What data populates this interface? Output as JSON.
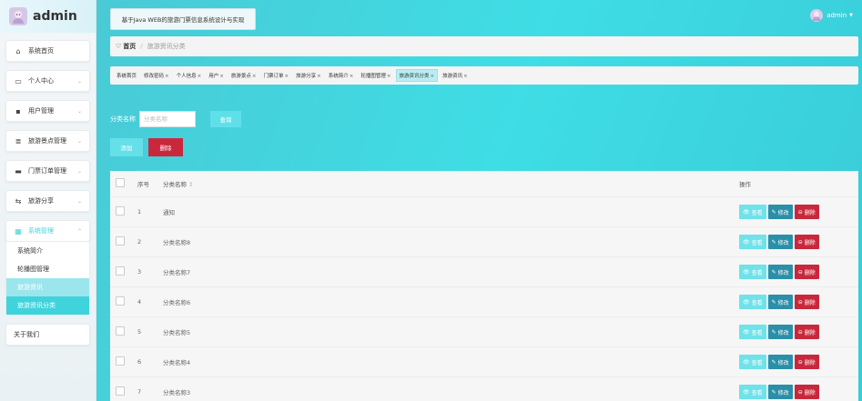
{
  "brand": {
    "name": "admin"
  },
  "header": {
    "system_title": "基于Java WEB的旅游门票信息系统设计与实现",
    "user_label": "admin"
  },
  "sidebar": {
    "items": [
      {
        "label": "系统首页",
        "icon": "home-icon"
      },
      {
        "label": "个人中心",
        "icon": "monitor-icon",
        "chevron": true
      },
      {
        "label": "用户管理",
        "icon": "user-icon",
        "chevron": true
      },
      {
        "label": "旅游景点管理",
        "icon": "list-icon",
        "chevron": true
      },
      {
        "label": "门票订单管理",
        "icon": "ticket-icon",
        "chevron": true
      },
      {
        "label": "旅游分享",
        "icon": "share-icon",
        "chevron": true
      },
      {
        "label": "系统管理",
        "icon": "grid-icon",
        "chevron": true
      }
    ],
    "submenu": [
      "系统简介",
      "轮播图管理",
      "旅游资讯",
      "旅游资讯分类"
    ],
    "about": "关于我们"
  },
  "breadcrumb": {
    "home": "首页",
    "current": "旅游资讯分类"
  },
  "tags": [
    {
      "label": "系统首页",
      "closable": false
    },
    {
      "label": "修改密码",
      "closable": true
    },
    {
      "label": "个人信息",
      "closable": true
    },
    {
      "label": "用户",
      "closable": true
    },
    {
      "label": "旅游景点",
      "closable": true
    },
    {
      "label": "门票订单",
      "closable": true
    },
    {
      "label": "旅游分享",
      "closable": true
    },
    {
      "label": "系统简介",
      "closable": true
    },
    {
      "label": "轮播图管理",
      "closable": true
    },
    {
      "label": "旅游资讯分类",
      "closable": true,
      "active": true
    },
    {
      "label": "旅游资讯",
      "closable": true
    }
  ],
  "search": {
    "label": "分类名称",
    "placeholder": "分类名称",
    "query_button": "查询"
  },
  "actions": {
    "add": "添加",
    "delete": "删除"
  },
  "table": {
    "headers": {
      "index": "序号",
      "name": "分类名称",
      "ops": "操作"
    },
    "rows": [
      {
        "index": "1",
        "name": "通知"
      },
      {
        "index": "2",
        "name": "分类名称8"
      },
      {
        "index": "3",
        "name": "分类名称7"
      },
      {
        "index": "4",
        "name": "分类名称6"
      },
      {
        "index": "5",
        "name": "分类名称5"
      },
      {
        "index": "6",
        "name": "分类名称4"
      },
      {
        "index": "7",
        "name": "分类名称3"
      }
    ],
    "ops": {
      "view": "查看",
      "edit": "修改",
      "delete": "删除"
    }
  },
  "colors": {
    "accent": "#3fd3dc",
    "danger": "#c9283c",
    "edit": "#2a8fa8"
  }
}
